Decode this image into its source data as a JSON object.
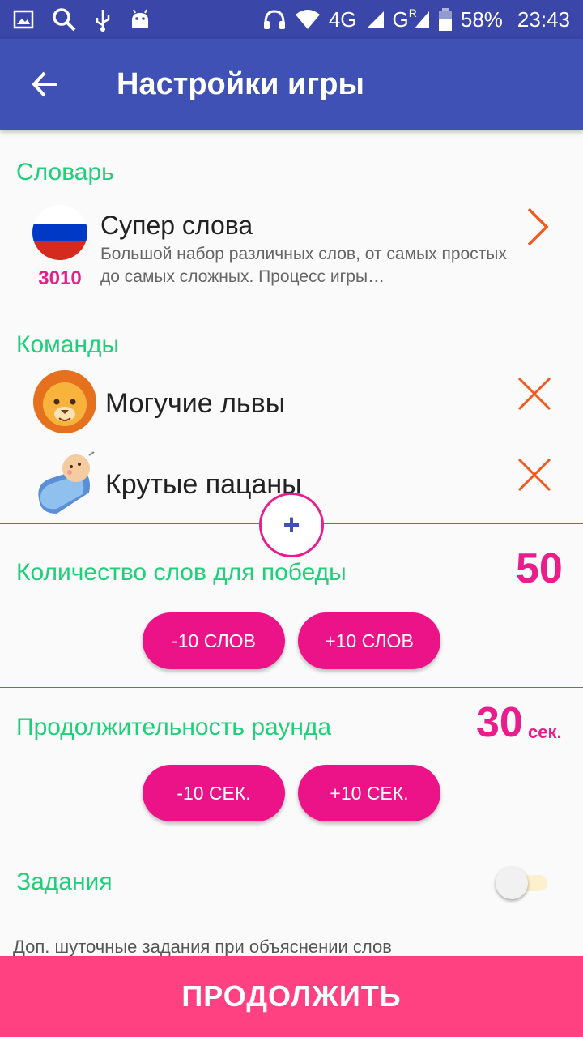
{
  "status_bar": {
    "network": "4G",
    "roaming": "R",
    "battery": "58%",
    "time": "23:43"
  },
  "app_bar": {
    "title": "Настройки игры"
  },
  "dictionary": {
    "section_title": "Словарь",
    "name": "Супер слова",
    "description": "Большой набор различных слов, от самых простых до самых сложных. Процесс игры…",
    "word_count": "3010"
  },
  "teams": {
    "section_title": "Команды",
    "items": [
      {
        "name": "Могучие львы",
        "avatar": "lion-icon"
      },
      {
        "name": "Крутые пацаны",
        "avatar": "baby-icon"
      }
    ],
    "add_label": "+"
  },
  "words_to_win": {
    "title": "Количество слов для победы",
    "value": "50",
    "minus_label": "-10 СЛОВ",
    "plus_label": "+10 СЛОВ"
  },
  "round_duration": {
    "title": "Продолжительность раунда",
    "value": "30",
    "unit": "сек.",
    "minus_label": "-10 СЕК.",
    "plus_label": "+10 СЕК."
  },
  "tasks": {
    "title": "Задания",
    "enabled": false,
    "description": "Доп. шуточные задания при объяснении слов"
  },
  "continue_label": "ПРОДОЛЖИТЬ",
  "colors": {
    "primary": "#3f51b5",
    "accent": "#e91e8c",
    "section": "#1fcf7a",
    "continue": "#ff4081"
  }
}
